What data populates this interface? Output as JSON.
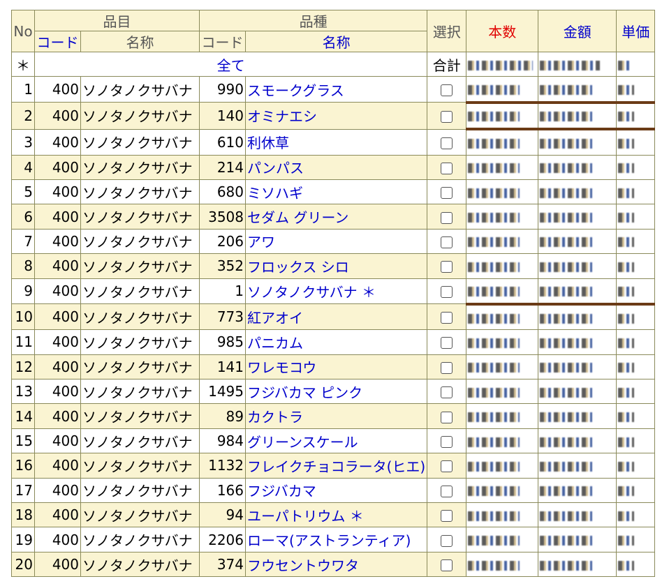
{
  "header": {
    "no": "No",
    "item_group": "品目",
    "variety_group": "品種",
    "code": "コード",
    "name": "名称",
    "select": "選択",
    "count": "本数",
    "amount": "金額",
    "unit_price": "単価"
  },
  "total_row": {
    "star": "＊",
    "all": "全て",
    "sum": "合計"
  },
  "rows": [
    {
      "no": "1",
      "item_code": "400",
      "item_name": "ソノタノクサバナ",
      "var_code": "990",
      "var_name": "スモークグラス"
    },
    {
      "no": "2",
      "item_code": "400",
      "item_name": "ソノタノクサバナ",
      "var_code": "140",
      "var_name": "オミナエシ"
    },
    {
      "no": "3",
      "item_code": "400",
      "item_name": "ソノタノクサバナ",
      "var_code": "610",
      "var_name": "利休草"
    },
    {
      "no": "4",
      "item_code": "400",
      "item_name": "ソノタノクサバナ",
      "var_code": "214",
      "var_name": "パンパス"
    },
    {
      "no": "5",
      "item_code": "400",
      "item_name": "ソノタノクサバナ",
      "var_code": "680",
      "var_name": "ミソハギ"
    },
    {
      "no": "6",
      "item_code": "400",
      "item_name": "ソノタノクサバナ",
      "var_code": "3508",
      "var_name": "セダム グリーン"
    },
    {
      "no": "7",
      "item_code": "400",
      "item_name": "ソノタノクサバナ",
      "var_code": "206",
      "var_name": "アワ"
    },
    {
      "no": "8",
      "item_code": "400",
      "item_name": "ソノタノクサバナ",
      "var_code": "352",
      "var_name": "フロックス シロ"
    },
    {
      "no": "9",
      "item_code": "400",
      "item_name": "ソノタノクサバナ",
      "var_code": "1",
      "var_name": "ソノタノクサバナ ＊"
    },
    {
      "no": "10",
      "item_code": "400",
      "item_name": "ソノタノクサバナ",
      "var_code": "773",
      "var_name": "紅アオイ"
    },
    {
      "no": "11",
      "item_code": "400",
      "item_name": "ソノタノクサバナ",
      "var_code": "985",
      "var_name": "パニカム"
    },
    {
      "no": "12",
      "item_code": "400",
      "item_name": "ソノタノクサバナ",
      "var_code": "141",
      "var_name": "ワレモコウ"
    },
    {
      "no": "13",
      "item_code": "400",
      "item_name": "ソノタノクサバナ",
      "var_code": "1495",
      "var_name": "フジバカマ ピンク"
    },
    {
      "no": "14",
      "item_code": "400",
      "item_name": "ソノタノクサバナ",
      "var_code": "89",
      "var_name": "カクトラ"
    },
    {
      "no": "15",
      "item_code": "400",
      "item_name": "ソノタノクサバナ",
      "var_code": "984",
      "var_name": "グリーンスケール"
    },
    {
      "no": "16",
      "item_code": "400",
      "item_name": "ソノタノクサバナ",
      "var_code": "1132",
      "var_name": "フレイクチョコラータ(ヒエ)"
    },
    {
      "no": "17",
      "item_code": "400",
      "item_name": "ソノタノクサバナ",
      "var_code": "166",
      "var_name": "フジバカマ"
    },
    {
      "no": "18",
      "item_code": "400",
      "item_name": "ソノタノクサバナ",
      "var_code": "94",
      "var_name": "ユーパトリウム ＊"
    },
    {
      "no": "19",
      "item_code": "400",
      "item_name": "ソノタノクサバナ",
      "var_code": "2206",
      "var_name": "ローマ(アストランティア)"
    },
    {
      "no": "20",
      "item_code": "400",
      "item_name": "ソノタノクサバナ",
      "var_code": "374",
      "var_name": "フウセントウワタ"
    }
  ]
}
